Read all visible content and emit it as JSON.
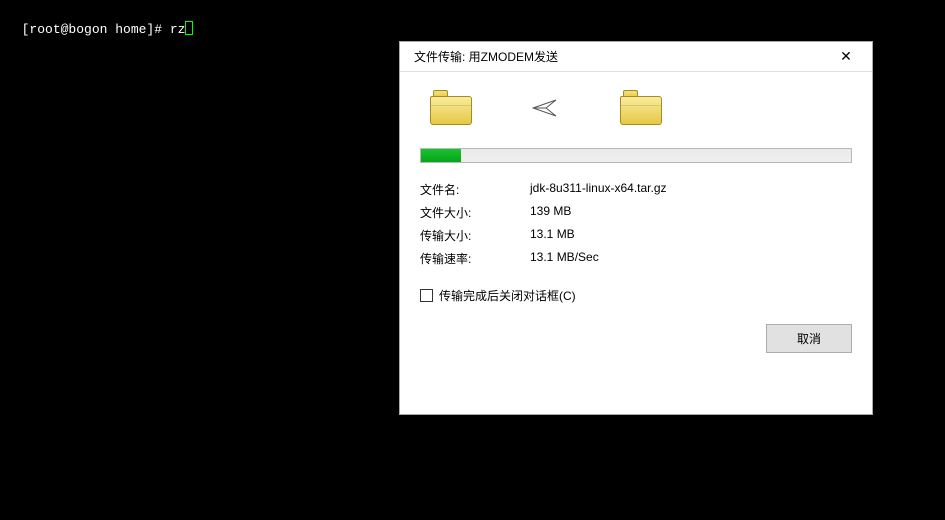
{
  "terminal": {
    "prompt": "[root@bogon home]# ",
    "command": "rz"
  },
  "dialog": {
    "title": "文件传输: 用ZMODEM发送",
    "progress_percent": 9.4,
    "rows": {
      "filename_label": "文件名:",
      "filename_value": "jdk-8u311-linux-x64.tar.gz",
      "filesize_label": "文件大小:",
      "filesize_value": "139 MB",
      "transferred_label": "传输大小:",
      "transferred_value": "13.1 MB",
      "rate_label": "传输速率:",
      "rate_value": "13.1 MB/Sec"
    },
    "checkbox_label": "传输完成后关闭对话框(C)",
    "checkbox_checked": false,
    "cancel_label": "取消"
  }
}
